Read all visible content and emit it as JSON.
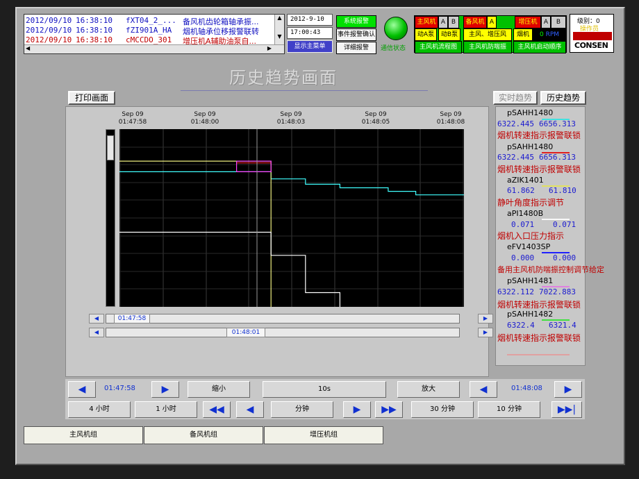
{
  "alarms": [
    {
      "date": "2012/09/10",
      "time": "16:38:10",
      "tag": "fXT04_2_...",
      "desc": "备风机齿轮箱轴承振...",
      "color": "#1010c0"
    },
    {
      "date": "2012/09/10",
      "time": "16:38:10",
      "tag": "fZI901A_HA",
      "desc": "烟机轴承位移报警联转",
      "color": "#1010c0"
    },
    {
      "date": "2012/09/10",
      "time": "16:38:10",
      "tag": "cMCCDO_301",
      "desc": "增压机A辅助油泵自...",
      "color": "#c00000"
    }
  ],
  "header": {
    "date": "2012-9-10",
    "time": "17:00:43",
    "show_menu": "显示主菜单",
    "sys_alarm": "系统报警",
    "event_ack": "事件报警确认",
    "detail_alarm": "详细报警",
    "comm_status": "通信状态"
  },
  "status_grid": {
    "main_fan": "主风机",
    "a": "A",
    "b": "B",
    "backup_fan": "备风机",
    "boost_fan": "增压机",
    "motor_a": "动A泵",
    "motor_b": "动B泵",
    "main_boost": "主风、增压风",
    "smoke": "烟机",
    "rpm_val": "0",
    "rpm_unit": "RPM",
    "flow_main": "主风机流程图",
    "surge": "主风机防喘振",
    "start_seq": "主风机启动顺序"
  },
  "user": {
    "level_label": "级别：",
    "level_value": "0",
    "role": "操作员",
    "logo": "CONSEN"
  },
  "page": {
    "title": "历史趋势画面",
    "print": "打印画面",
    "realtime": "实时趋势",
    "history": "历史趋势"
  },
  "chart_data": {
    "type": "line",
    "x_ticks": [
      {
        "day": "Sep 09",
        "time": "01:47:58"
      },
      {
        "day": "Sep 09",
        "time": "01:48:00"
      },
      {
        "day": "Sep 09",
        "time": "01:48:03"
      },
      {
        "day": "Sep 09",
        "time": "01:48:05"
      },
      {
        "day": "Sep 09",
        "time": "01:48:08"
      }
    ],
    "x_range": [
      "01:47:58",
      "01:48:08"
    ],
    "grid": true,
    "cursor_time": "01:48:01",
    "background": "#000000",
    "series": [
      {
        "name": "pSAHH1480",
        "color": "#40ffff",
        "steps": [
          [
            0,
            0.24
          ],
          [
            0.44,
            0.24
          ],
          [
            0.44,
            0.28
          ],
          [
            0.54,
            0.28
          ],
          [
            0.54,
            0.31
          ],
          [
            0.64,
            0.31
          ],
          [
            0.64,
            0.33
          ],
          [
            0.78,
            0.33
          ],
          [
            0.78,
            0.35
          ],
          [
            0.86,
            0.35
          ],
          [
            0.86,
            0.37
          ],
          [
            1.0,
            0.37
          ]
        ]
      },
      {
        "name": "pSAHH1480",
        "color": "#e02020",
        "steps": [
          [
            0.34,
            0.19
          ],
          [
            0.44,
            0.19
          ]
        ]
      },
      {
        "name": "aZIK1401",
        "color": "#f0f080",
        "steps": [
          [
            0,
            0.18
          ],
          [
            0.44,
            0.18
          ],
          [
            0.44,
            1.0
          ]
        ]
      },
      {
        "name": "aPI1480B",
        "color": "#ffffff",
        "steps": [
          [
            0,
            0.58
          ],
          [
            0.44,
            0.58
          ],
          [
            0.44,
            0.71
          ],
          [
            0.54,
            0.71
          ],
          [
            0.54,
            0.92
          ],
          [
            0.64,
            0.92
          ],
          [
            0.64,
            1.0
          ]
        ]
      },
      {
        "name": "ePV1403SP",
        "color": "#2020ff",
        "steps": []
      },
      {
        "name": "pSAHH1481",
        "color": "#ff40ff",
        "steps": [
          [
            0.34,
            0.18
          ],
          [
            0.44,
            0.18
          ],
          [
            0.44,
            0.24
          ],
          [
            0.34,
            0.24
          ],
          [
            0.34,
            0.18
          ]
        ]
      },
      {
        "name": "pSAHH1482",
        "color": "#40ff40",
        "steps": []
      }
    ]
  },
  "scrollbars": {
    "start": "01:47:58",
    "cursor": "01:48:01"
  },
  "legend": [
    {
      "tag": "pSAHH1480",
      "min": "6322.445",
      "max": "6656.313",
      "desc": "烟机转速指示报警联锁",
      "color": "#40e0e0"
    },
    {
      "tag": "pSAHH1480",
      "min": "6322.445",
      "max": "6656.313",
      "desc": "烟机转速指示报警联锁",
      "color": "#e02020"
    },
    {
      "tag": "aZIK1401",
      "min": "61.862",
      "max": "61.810",
      "desc": "静叶角度指示调节",
      "color": "#e0e060"
    },
    {
      "tag": "aPI1480B",
      "min": "0.071",
      "max": "0.071",
      "desc": "烟机入口压力指示",
      "color": "#f8f8f8"
    },
    {
      "tag": "eFV1403SP",
      "min": "0.000",
      "max": "0.000",
      "desc": "备用主风机防喘振控制调节给定",
      "color": "#2020ff"
    },
    {
      "tag": "pSAHH1481",
      "min": "6322.112",
      "max": "7022.883",
      "desc": "烟机转速指示报警联锁",
      "color": "#e080e0"
    },
    {
      "tag": "pSAHH1482",
      "min": "6322.4",
      "max": "6321.4",
      "desc": "烟机转速指示报警联锁",
      "color": "#40e040"
    }
  ],
  "controls": {
    "start_time": "01:47:58",
    "end_time": "01:48:08",
    "zoom_out": "缩小",
    "interval": "10s",
    "zoom_in": "放大",
    "h4": "4 小时",
    "h1": "1 小时",
    "minute": "分钟",
    "m30": "30 分钟",
    "m10": "10 分钟"
  },
  "tabs": [
    "主风机组",
    "备风机组",
    "增压机组"
  ]
}
